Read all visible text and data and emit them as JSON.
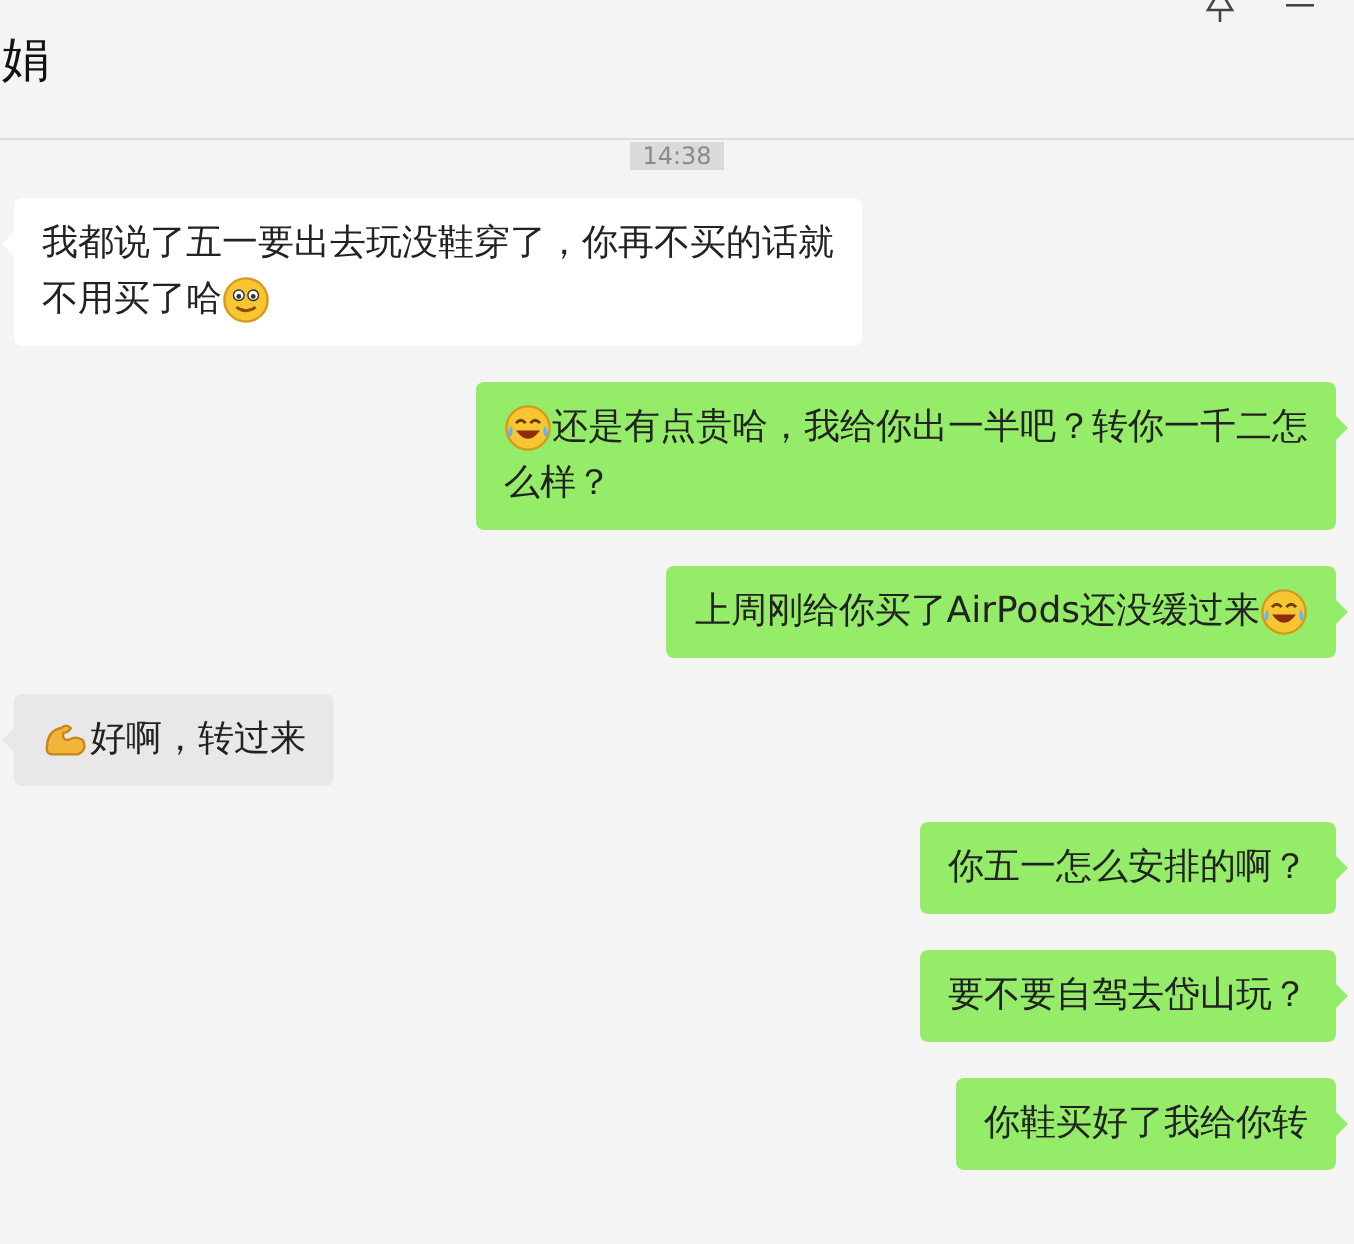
{
  "header": {
    "title": "娟"
  },
  "time": "14:38",
  "messages": [
    {
      "kind": "received",
      "lines": [
        [
          {
            "kind": "text",
            "text": "我都说了五一要出去玩没鞋穿了，你再不买的话就"
          }
        ],
        [
          {
            "kind": "text",
            "text": "不用买了哈"
          },
          {
            "kind": "smile"
          }
        ]
      ]
    },
    {
      "kind": "sent",
      "lines": [
        [
          {
            "kind": "laugh"
          },
          {
            "kind": "text",
            "text": "还是有点贵哈，我给你出一半吧？转你一千二怎"
          }
        ],
        [
          {
            "kind": "text",
            "text": "么样？"
          }
        ]
      ]
    },
    {
      "kind": "sent",
      "lines": [
        [
          {
            "kind": "text",
            "text": "上周刚给你买了AirPods还没缓过来"
          },
          {
            "kind": "laugh"
          }
        ]
      ]
    },
    {
      "kind": "received",
      "lines": [
        [
          {
            "kind": "flex"
          },
          {
            "kind": "text",
            "text": "好啊，转过来"
          }
        ]
      ]
    },
    {
      "kind": "sent",
      "lines": [
        [
          {
            "kind": "text",
            "text": "你五一怎么安排的啊？"
          }
        ]
      ]
    },
    {
      "kind": "sent",
      "lines": [
        [
          {
            "kind": "text",
            "text": "要不要自驾去岱山玩？"
          }
        ]
      ]
    },
    {
      "kind": "sent",
      "lines": [
        [
          {
            "kind": "text",
            "text": "你鞋买好了我给你转"
          }
        ]
      ]
    }
  ]
}
